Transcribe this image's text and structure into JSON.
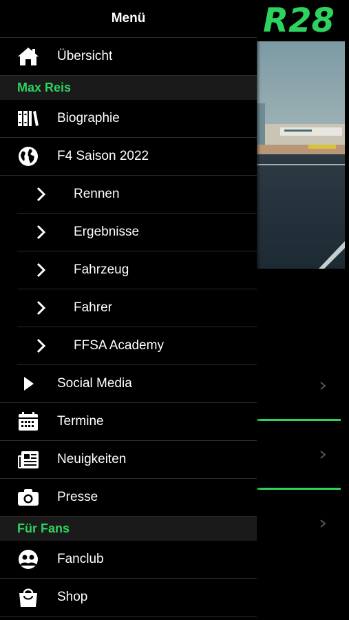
{
  "drawer": {
    "title": "Menü",
    "overview": "Übersicht",
    "section_max_reis": "Max Reis",
    "biography": "Biographie",
    "season": "F4 Saison 2022",
    "sub_items": [
      "Rennen",
      "Ergebnisse",
      "Fahrzeug",
      "Fahrer",
      "FFSA Academy"
    ],
    "social_media": "Social Media",
    "appointments": "Termine",
    "news": "Neuigkeiten",
    "press": "Presse",
    "section_fans": "Für Fans",
    "fanclub": "Fanclub",
    "shop": "Shop"
  },
  "background_app": {
    "logo_text": "R28"
  },
  "colors": {
    "accent": "#2ed35f",
    "background": "#000000",
    "section_bg": "#1a1a1a",
    "divider": "#2b2b2b"
  },
  "icons": {
    "overview": "home-icon",
    "biography": "books-icon",
    "season": "globe-icon",
    "sub_item": "chevron-right-icon",
    "social_media": "play-icon",
    "appointments": "calendar-icon",
    "news": "newspaper-icon",
    "press": "camera-icon",
    "fanclub": "users-icon",
    "shop": "shopping-bag-icon"
  }
}
